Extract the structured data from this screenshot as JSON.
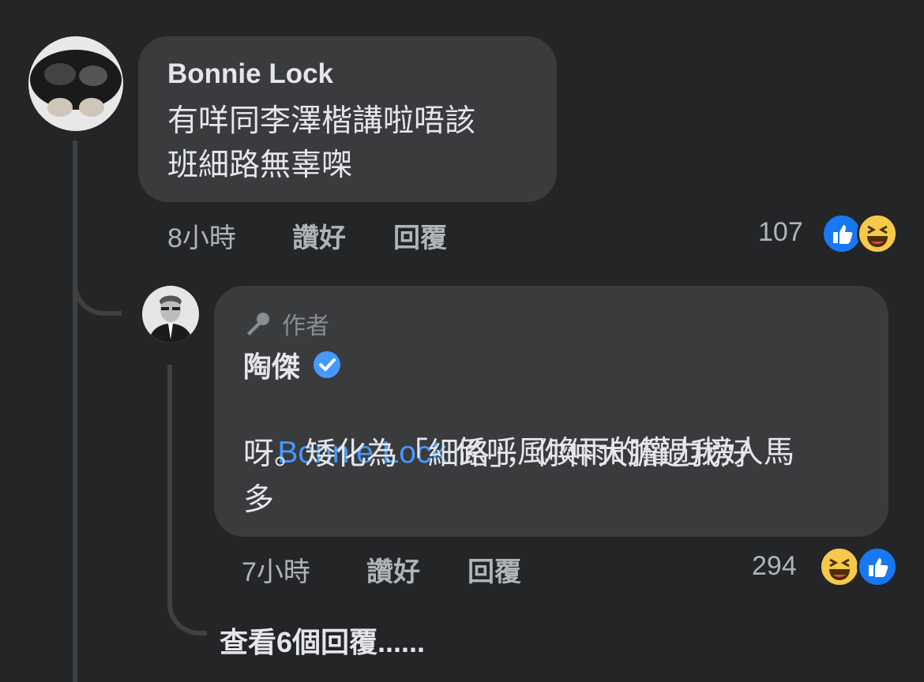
{
  "comment": {
    "author": "Bonnie Lock",
    "text_line1": "有咩同李澤楷講啦唔該",
    "text_line2": "班細路無辜㗎",
    "time": "8小時",
    "like_label": "讚好",
    "reply_label": "回覆",
    "reaction_count": "107",
    "reactions": [
      "like-icon",
      "haha-icon"
    ]
  },
  "reply": {
    "author_badge_label": "作者",
    "author": "陶傑",
    "mention": "Bonnie Lock",
    "text_line1": " 係呼風喚雨的權力榜人馬",
    "text_line2": "呀。矮化為「細路」，你仲大膽過我好",
    "text_line3": "多",
    "time": "7小時",
    "like_label": "讚好",
    "reply_label": "回覆",
    "reaction_count": "294",
    "reactions": [
      "haha-icon",
      "like-icon"
    ]
  },
  "view_more": "查看6個回覆......",
  "colors": {
    "background": "#242526",
    "bubble": "#3a3b3c",
    "link": "#4599ff",
    "like": "#1877f2",
    "haha": "#f7c94a"
  }
}
